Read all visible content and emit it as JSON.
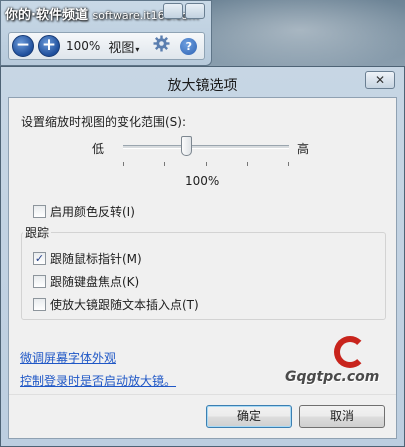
{
  "magnifier": {
    "watermark_text": "你的·软件频道",
    "watermark_url": "software.it168.com",
    "zoom_out_glyph": "−",
    "zoom_in_glyph": "+",
    "zoom_level": "100%",
    "view_label": "视图",
    "view_caret": "▾",
    "icons": [
      "zoom-out-icon",
      "zoom-in-icon",
      "gear-icon",
      "help-icon"
    ]
  },
  "dialog": {
    "title": "放大镜选项",
    "close_glyph": "✕",
    "range_label": "设置缩放时视图的变化范围(S):",
    "slider": {
      "low_label": "低",
      "high_label": "高",
      "value": "100%",
      "position_fraction": 0.35
    },
    "invert_colors": {
      "label": "启用颜色反转(I)",
      "checked": false
    },
    "tracking": {
      "group_label": "跟踪",
      "options": [
        {
          "label": "跟随鼠标指针(M)",
          "checked": true
        },
        {
          "label": "跟随键盘焦点(K)",
          "checked": false
        },
        {
          "label": "使放大镜跟随文本插入点(T)",
          "checked": false
        }
      ]
    },
    "links": {
      "fine_tune": "微调屏幕字体外观",
      "startup": "控制登录时是否启动放大镜。"
    },
    "watermark_logo": "Gqgtpc.com",
    "buttons": {
      "ok": "确定",
      "cancel": "取消"
    }
  }
}
